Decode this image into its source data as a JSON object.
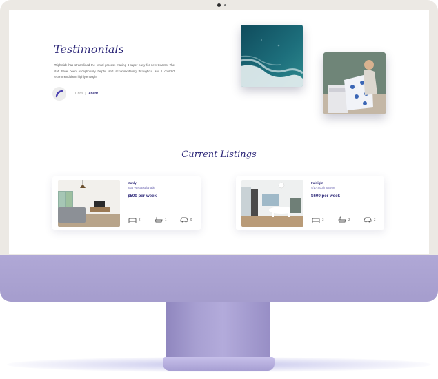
{
  "testimonials": {
    "title": "Testimonials",
    "quote": "\"Rightside has streamlined the rental process making it super easy for new tenants. The staff have been exceptionally helpful and accommodating throughout and I couldn't recommend them highly enough!\"",
    "author_name": "Chris",
    "author_separator": "|",
    "author_role": "Tenant"
  },
  "listings": {
    "title": "Current Listings",
    "cards": [
      {
        "name": "Manly",
        "address": "2/35 West Esplanade",
        "price": "$500 per week",
        "beds": "2",
        "baths": "1",
        "cars": "0"
      },
      {
        "name": "Fairlight",
        "address": "4/17 South Steyne",
        "price": "$600 per week",
        "beds": "3",
        "baths": "2",
        "cars": "2"
      }
    ]
  },
  "icons": {
    "bed": "bed-icon",
    "bath": "bath-icon",
    "car": "car-icon"
  },
  "colors": {
    "accent": "#2f2a7a",
    "monitor_chin": "#a59dcd",
    "bezel": "#ece9e4"
  }
}
